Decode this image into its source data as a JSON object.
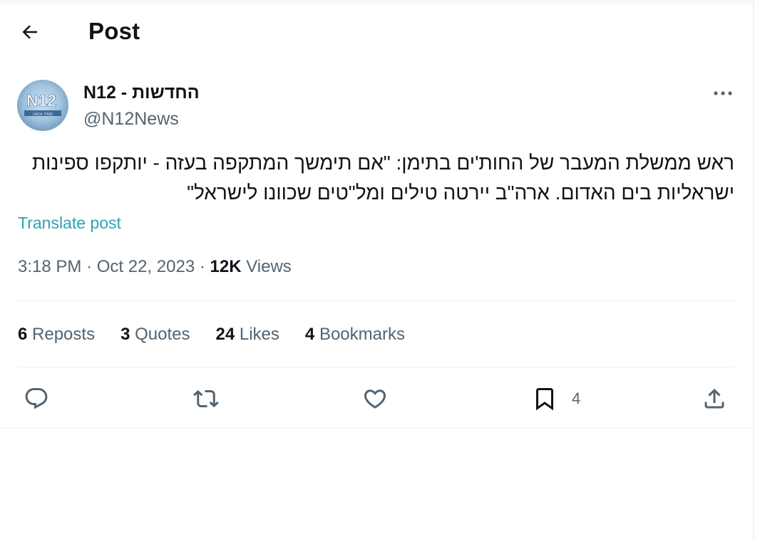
{
  "header": {
    "back_icon": "arrow-left-icon",
    "title": "Post"
  },
  "author": {
    "avatar_text": "N12",
    "avatar_subtext": "תמיד נכונה",
    "name": "N12 - החדשות",
    "handle": "@N12News",
    "more_icon": "more-horizontal-icon"
  },
  "post": {
    "text": "ראש ממשלת המעבר של החות'ים בתימן: \"אם תימשך המתקפה בעזה - יותקפו ספינות ישראליות בים האדום. ארה\"ב יירטה טילים ומל\"טים שכוונו לישראל\"",
    "translate_label": "Translate post"
  },
  "meta": {
    "time": "3:18 PM",
    "separator": "·",
    "date": "Oct 22, 2023",
    "views_count": "12K",
    "views_label": "Views"
  },
  "stats": [
    {
      "count": "6",
      "label": "Reposts"
    },
    {
      "count": "3",
      "label": "Quotes"
    },
    {
      "count": "24",
      "label": "Likes"
    },
    {
      "count": "4",
      "label": "Bookmarks"
    }
  ],
  "actions": {
    "reply_icon": "reply-icon",
    "repost_icon": "repost-icon",
    "like_icon": "heart-icon",
    "bookmark_icon": "bookmark-icon",
    "bookmark_count": "4",
    "share_icon": "share-icon"
  },
  "colors": {
    "text": "#0f1419",
    "secondary": "#536471",
    "link": "#2aa3b4",
    "border": "#eff3f4"
  }
}
